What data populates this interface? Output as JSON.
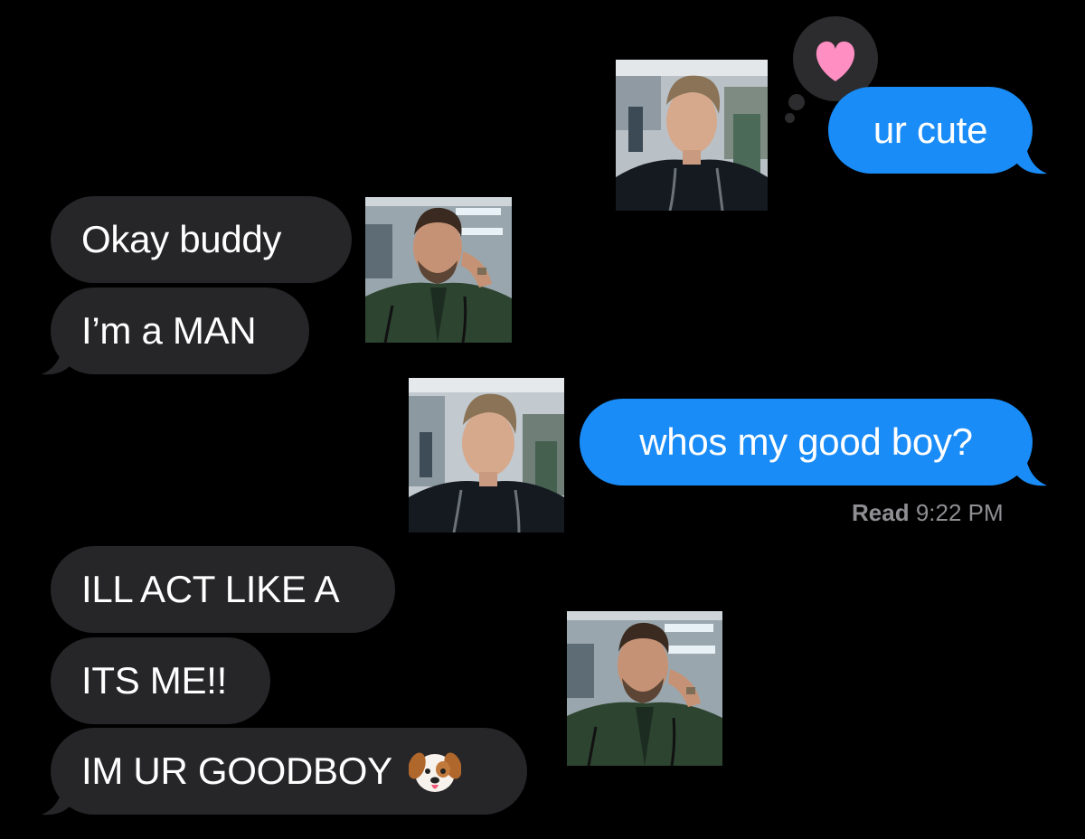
{
  "conversation": {
    "messages": [
      {
        "sender": "me",
        "text": "ur cute"
      },
      {
        "sender": "them",
        "text": "Okay buddy"
      },
      {
        "sender": "them",
        "text": "I’m a MAN"
      },
      {
        "sender": "me",
        "text": "whos my good boy?"
      },
      {
        "sender": "them",
        "text": "ILL ACT LIKE A"
      },
      {
        "sender": "them",
        "text": "ITS ME!!"
      },
      {
        "sender": "them",
        "text": "IM UR GOODBOY"
      }
    ],
    "goodboy_emoji": "dog-face-emoji",
    "reaction": {
      "icon": "heart-icon",
      "color": "#ff8fc2"
    },
    "read_receipt": {
      "label": "Read",
      "time": "9:22 PM"
    }
  },
  "colors": {
    "background": "#000000",
    "incoming_bubble": "#262629",
    "outgoing_bubble": "#1a8cf7",
    "text": "#ffffff",
    "receipt": "#8e8e93"
  },
  "photos": [
    {
      "name": "doctor-dark-scrubs-photo"
    },
    {
      "name": "doctor-green-jacket-photo"
    },
    {
      "name": "doctor-dark-scrubs-photo"
    },
    {
      "name": "doctor-green-jacket-photo"
    }
  ]
}
